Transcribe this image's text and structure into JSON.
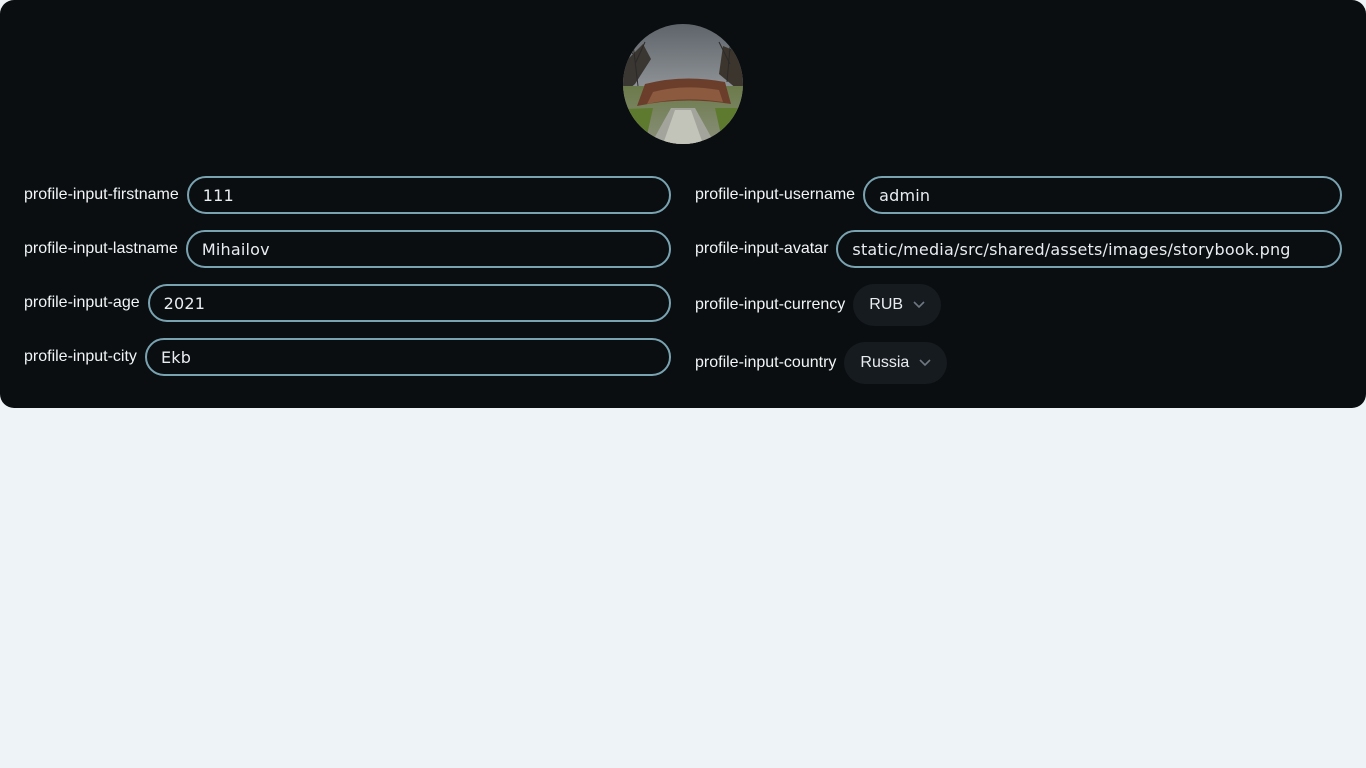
{
  "profile": {
    "avatar_alt": "avatar",
    "fields_left": [
      {
        "label": "profile-input-firstname",
        "value": "111"
      },
      {
        "label": "profile-input-lastname",
        "value": "Mihailov"
      },
      {
        "label": "profile-input-age",
        "value": "2021"
      },
      {
        "label": "profile-input-city",
        "value": "Ekb"
      }
    ],
    "fields_right": [
      {
        "label": "profile-input-username",
        "value": "admin"
      },
      {
        "label": "profile-input-avatar",
        "value": "static/media/src/shared/assets/images/storybook.png"
      }
    ],
    "currency": {
      "label": "profile-input-currency",
      "value": "RUB"
    },
    "country": {
      "label": "profile-input-country",
      "value": "Russia"
    }
  },
  "icons": {
    "select_chevron": "chevron-down-icon"
  },
  "colors": {
    "card_bg": "#0a0e11",
    "page_bg": "#eef3f7",
    "input_border": "#7aa3b2",
    "select_bg": "#161b20",
    "text": "#f2f4f6"
  }
}
